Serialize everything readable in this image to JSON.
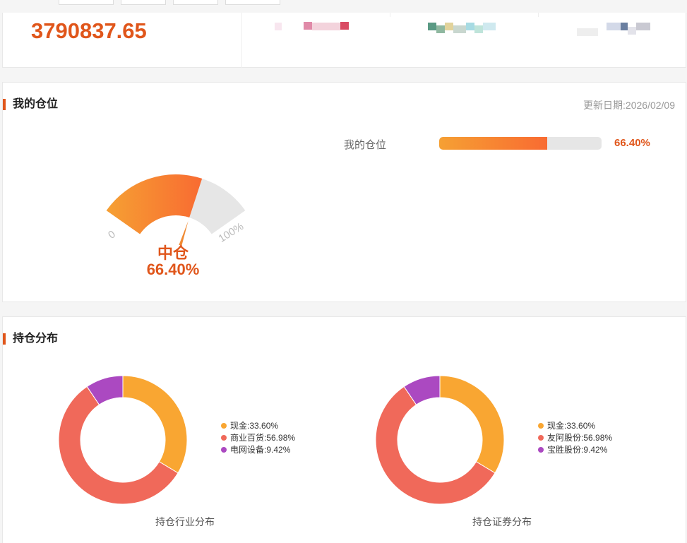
{
  "summary": {
    "total_value": "3790837.65"
  },
  "position": {
    "title": "我的仓位",
    "update_date": "更新日期:2026/02/09",
    "gauge": {
      "min_label": "0",
      "max_label": "100%",
      "level_label": "中仓",
      "value_label": "66.40%",
      "fraction": 0.664
    },
    "bar": {
      "label": "我的仓位",
      "value_label": "66.40%",
      "fraction": 0.664
    }
  },
  "distribution": {
    "title": "持仓分布",
    "charts": [
      {
        "caption": "持仓行业分布",
        "legend": [
          "现金:33.60%",
          "商业百货:56.98%",
          "电网设备:9.42%"
        ]
      },
      {
        "caption": "持仓证券分布",
        "legend": [
          "现金:33.60%",
          "友阿股份:56.98%",
          "宝胜股份:9.42%"
        ]
      }
    ]
  },
  "chart_data": [
    {
      "type": "pie",
      "title": "持仓行业分布",
      "categories": [
        "现金",
        "商业百货",
        "电网设备"
      ],
      "values": [
        33.6,
        56.98,
        9.42
      ],
      "colors": [
        "#f9a632",
        "#f0695a",
        "#ab49c1"
      ],
      "legend_position": "right"
    },
    {
      "type": "pie",
      "title": "持仓证券分布",
      "categories": [
        "现金",
        "友阿股份",
        "宝胜股份"
      ],
      "values": [
        33.6,
        56.98,
        9.42
      ],
      "colors": [
        "#f9a632",
        "#f0695a",
        "#ab49c1"
      ],
      "legend_position": "right"
    }
  ],
  "colors": {
    "accent": "#e0561b",
    "gauge_start": "#f6a033",
    "gauge_end": "#f86b32",
    "track": "#e6e6e6"
  }
}
